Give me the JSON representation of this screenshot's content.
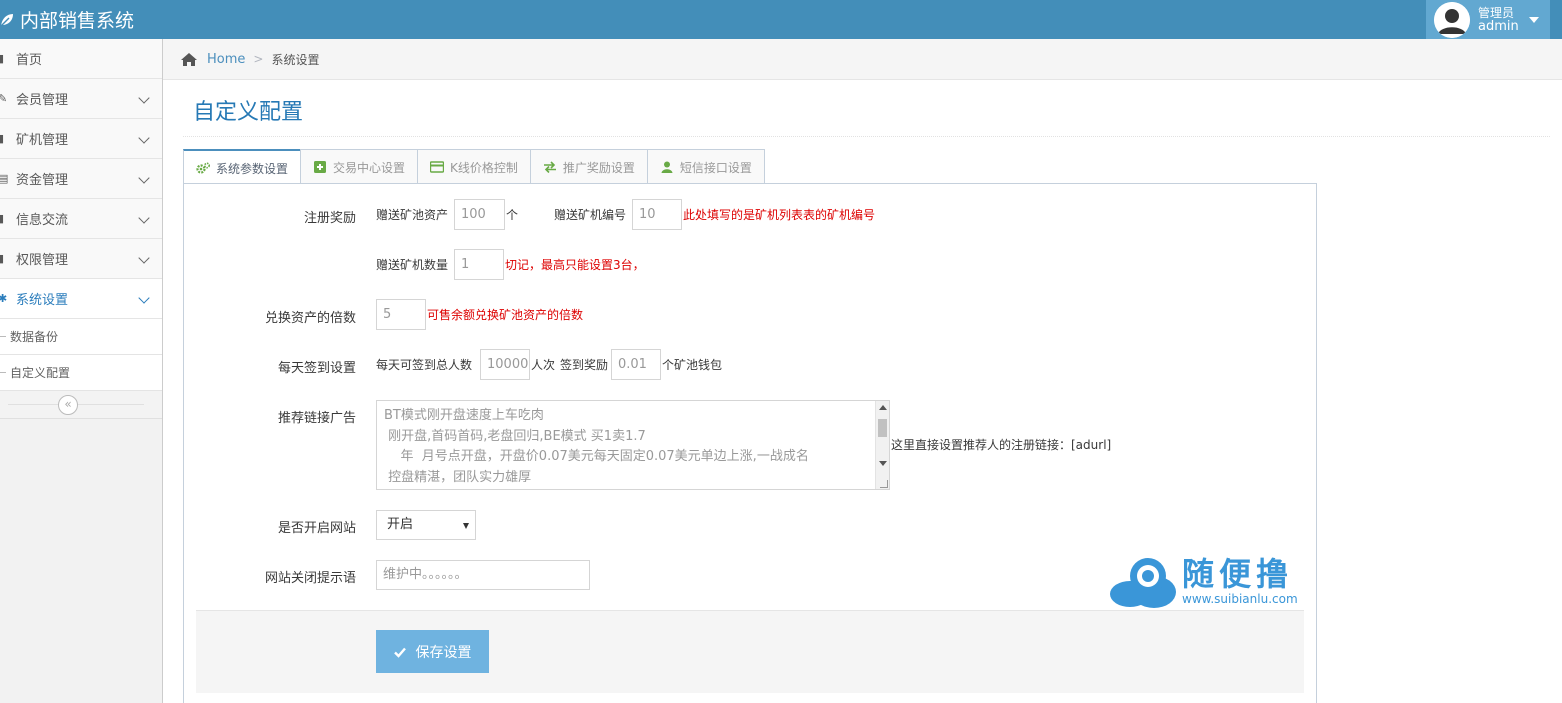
{
  "app": {
    "title": "内部销售系统",
    "user_role": "管理员",
    "user_name": "admin"
  },
  "sidebar": {
    "items": [
      {
        "label": "首页",
        "icon": "dashboard-icon"
      },
      {
        "label": "会员管理",
        "icon": "users-icon"
      },
      {
        "label": "矿机管理",
        "icon": "machine-icon"
      },
      {
        "label": "资金管理",
        "icon": "money-icon"
      },
      {
        "label": "信息交流",
        "icon": "message-icon"
      },
      {
        "label": "权限管理",
        "icon": "lock-icon"
      },
      {
        "label": "系统设置",
        "icon": "settings-icon"
      }
    ],
    "sub_items": [
      {
        "label": "数据备份"
      },
      {
        "label": "自定义配置"
      }
    ],
    "collapse_glyph": "«"
  },
  "breadcrumb": {
    "home": "Home",
    "separator": ">",
    "current": "系统设置"
  },
  "page": {
    "title": "自定义配置"
  },
  "tabs": [
    {
      "label": "系统参数设置",
      "active": true
    },
    {
      "label": "交易中心设置",
      "active": false
    },
    {
      "label": "K线价格控制",
      "active": false
    },
    {
      "label": "推广奖励设置",
      "active": false
    },
    {
      "label": "短信接口设置",
      "active": false
    }
  ],
  "form": {
    "register_reward": {
      "label": "注册奖励",
      "asset_label": "赠送矿池资产",
      "asset_value": "100",
      "asset_unit": "个",
      "machine_id_label": "赠送矿机编号",
      "machine_id_value": "10",
      "machine_id_hint": "此处填写的是矿机列表表的矿机编号",
      "machine_count_label": "赠送矿机数量",
      "machine_count_value": "1",
      "machine_count_hint": "切记，最高只能设置3台，"
    },
    "exchange": {
      "label": "兑换资产的倍数",
      "value": "5",
      "hint": "可售余额兑换矿池资产的倍数"
    },
    "checkin": {
      "label": "每天签到设置",
      "total_label": "每天可签到总人数",
      "total_value": "10000",
      "total_unit": "人次",
      "reward_label": "签到奖励",
      "reward_value": "0.01",
      "reward_unit": "个矿池钱包"
    },
    "ad": {
      "label": "推荐链接广告",
      "text": "BT模式刚开盘速度上车吃肉\n 刚开盘,首码首码,老盘回归,BE模式 买1卖1.7\n    年  月号点开盘，开盘价0.07美元每天固定0.07美元单边上涨,一战成名\n 控盘精湛，团队实力雄厚\n 全程一对一指导，新手也能轻松上手",
      "hint": "这里直接设置推荐人的注册链接：[adurl]"
    },
    "site_open": {
      "label": "是否开启网站",
      "value": "开启"
    },
    "close_msg": {
      "label": "网站关闭提示语",
      "placeholder": "维护中。。。。。。"
    },
    "save_label": "保存设置"
  },
  "watermark": {
    "text": "随便撸",
    "url": "www.suibianlu.com"
  },
  "colors": {
    "navbar": "#438eb9",
    "user_box": "#62a8d1",
    "title": "#2679b5",
    "hint_red": "#dd0000",
    "save_button": "#6fb3e0"
  }
}
